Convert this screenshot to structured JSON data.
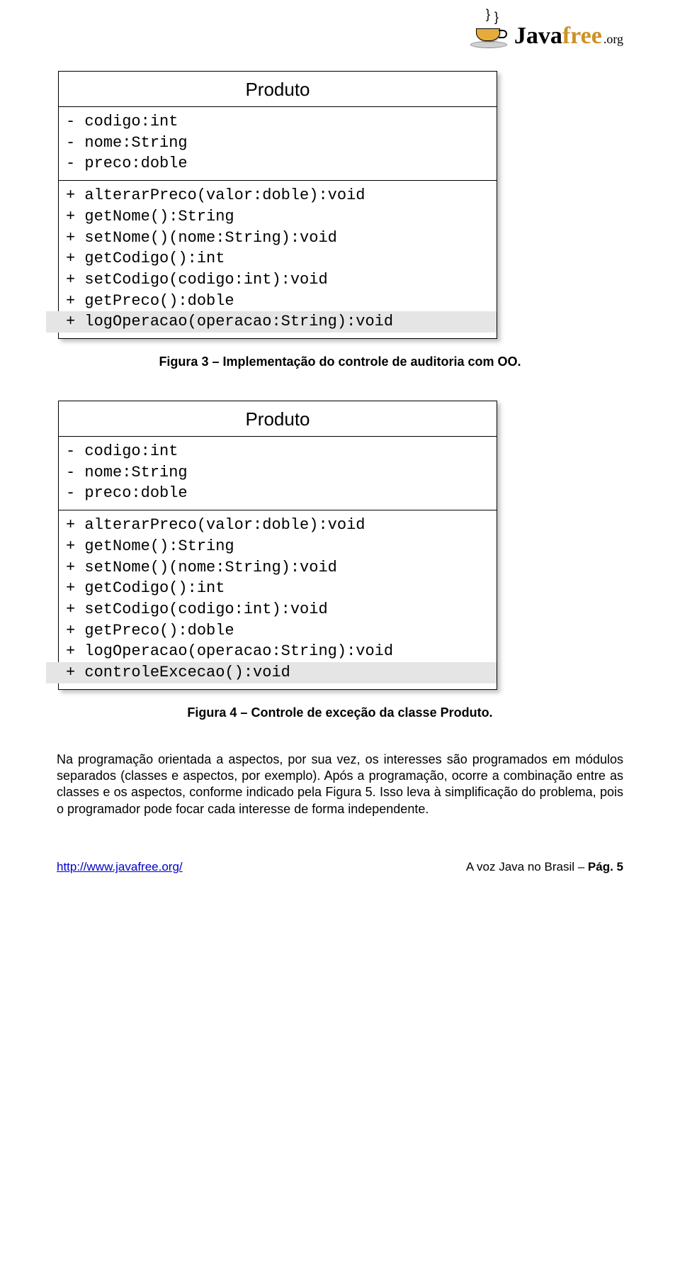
{
  "logo": {
    "word1": "Java",
    "word2": "free",
    "suffix": ".org"
  },
  "uml1": {
    "title": "Produto",
    "attrs": [
      "- codigo:int",
      "- nome:String",
      "- preco:doble"
    ],
    "ops": [
      "+ alterarPreco(valor:doble):void",
      "+ getNome():String",
      "+ setNome()(nome:String):void",
      "+ getCodigo():int",
      "+ setCodigo(codigo:int):void",
      "+ getPreco():doble"
    ],
    "ops_hl": [
      "+ logOperacao(operacao:String):void"
    ]
  },
  "caption1": "Figura 3 – Implementação do controle de auditoria com OO.",
  "uml2": {
    "title": "Produto",
    "attrs": [
      "- codigo:int",
      "- nome:String",
      "- preco:doble"
    ],
    "ops": [
      "+ alterarPreco(valor:doble):void",
      "+ getNome():String",
      "+ setNome()(nome:String):void",
      "+ getCodigo():int",
      "+ setCodigo(codigo:int):void",
      "+ getPreco():doble",
      "+ logOperacao(operacao:String):void"
    ],
    "ops_hl": [
      "+ controleExcecao():void"
    ]
  },
  "caption2": "Figura 4 – Controle de exceção da classe Produto.",
  "paragraph": "Na programação orientada a aspectos, por sua vez, os interesses são programados em módulos separados (classes e aspectos, por exemplo). Após a programação, ocorre a combinação entre as classes e os aspectos, conforme indicado pela Figura 5. Isso leva à simplificação do problema, pois o programador pode focar cada interesse de forma independente.",
  "footer": {
    "url": "http://www.javafree.org/",
    "right_prefix": "A voz Java no Brasil – ",
    "right_bold": "Pág. 5"
  }
}
